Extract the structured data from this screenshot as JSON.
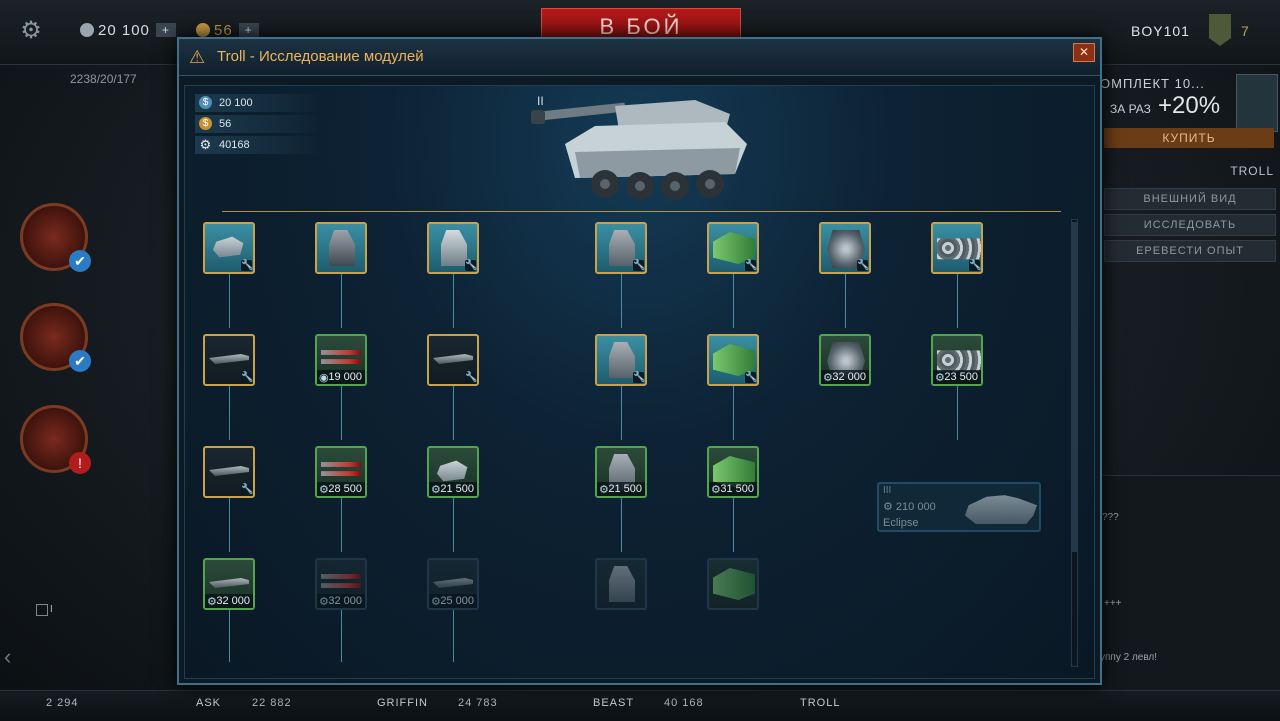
{
  "topbar": {
    "silver": "20 100",
    "gold": "56",
    "plus": "+",
    "battle": "В БОЙ",
    "player": "BOY101",
    "level": "7",
    "stats": "2238/20/177"
  },
  "right_panel": {
    "promo_title": "ОМПЛЕКТ 10...",
    "promo_sub": "ЗА РАЗ",
    "promo_bonus": "+20%",
    "buy": "КУПИТЬ",
    "tank_label": "TROLL",
    "btn_appearance": "ВНЕШНИЙ ВИД",
    "btn_research": "ИССЛЕДОВАТЬ",
    "btn_transfer": "ЕРЕВЕСТИ ОПЫТ"
  },
  "chat": {
    "line1": "???",
    "line2": "+++",
    "line3": "уппу 2 левл!"
  },
  "bottom": {
    "slot_num": "I",
    "slots": [
      {
        "value": "2 294",
        "name": "ASK"
      },
      {
        "value": "22 882",
        "name": "GRIFFIN"
      },
      {
        "value": "24 783",
        "name": "BEAST"
      },
      {
        "value": "40 168",
        "name": "TROLL"
      }
    ]
  },
  "modal": {
    "title": "Troll - Исследование модулей",
    "close": "✕",
    "silver": "20 100",
    "gold": "56",
    "xp": "40168",
    "tier": "II",
    "next_tank": {
      "tier": "III",
      "price": "210 000",
      "name": "Eclipse"
    },
    "nodes": {
      "c1r1": "",
      "c2r1": "",
      "c3r1": "",
      "c4r1": "",
      "c5r1": "",
      "c6r1": "",
      "c7r1": "",
      "c2r2": "19 000",
      "c6r2": "32 000",
      "c7r2": "23 500",
      "c2r3": "28 500",
      "c3r3": "21 500",
      "c4r3": "21 500",
      "c5r3": "31 500",
      "c1r4": "32 000",
      "c2r4": "32 000",
      "c3r4": "25 000"
    }
  },
  "colors": {
    "accent_gold": "#caa24c",
    "research_green": "#54a34e",
    "battle_red": "#b51a1a"
  }
}
